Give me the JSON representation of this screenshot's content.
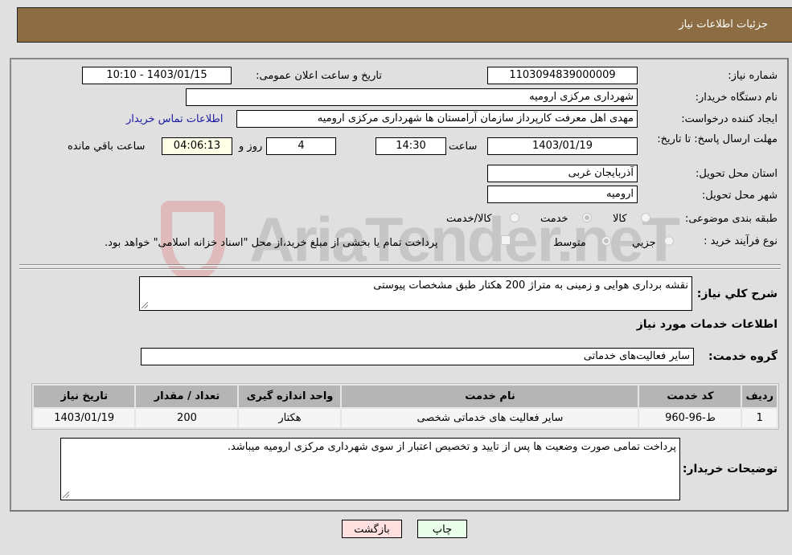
{
  "header": {
    "title": "جزئیات اطلاعات نیاز"
  },
  "form": {
    "need_number": {
      "label": "شماره نیاز:",
      "value": "1103094839000009"
    },
    "announce_datetime": {
      "label": "تاریخ و ساعت اعلان عمومی:",
      "value": "1403/01/15 - 10:10"
    },
    "buyer_org": {
      "label": "نام دستگاه خریدار:",
      "value": "شهرداری مرکزی ارومیه"
    },
    "creator": {
      "label": "ایجاد کننده درخواست:",
      "value": "مهدی اهل معرفت کارپرداز سازمان آرامستان ها شهرداری مرکزی ارومیه",
      "contact_link": "اطلاعات تماس خریدار"
    },
    "deadline": {
      "label": "مهلت ارسال پاسخ: تا تاریخ:",
      "date": "1403/01/19",
      "time_label": "ساعت",
      "time": "14:30",
      "days": "4",
      "days_label": "روز و",
      "remaining": "04:06:13",
      "remaining_label": "ساعت باقي مانده"
    },
    "province": {
      "label": "استان محل تحویل:",
      "value": "آذربایجان غربی"
    },
    "city": {
      "label": "شهر محل تحویل:",
      "value": "ارومیه"
    },
    "category": {
      "label": "طبقه بندی موضوعی:",
      "options": [
        {
          "label": "کالا",
          "checked": false
        },
        {
          "label": "خدمت",
          "checked": true
        },
        {
          "label": "کالا/خدمت",
          "checked": false
        }
      ]
    },
    "purchase_type": {
      "label": "نوع فرآیند خرید :",
      "options": [
        {
          "label": "جزيي",
          "checked": false
        },
        {
          "label": "متوسط",
          "checked": true
        }
      ],
      "treasury_note": "پرداخت تمام یا بخشی از مبلغ خرید،از محل \"اسناد خزانه اسلامی\" خواهد بود."
    },
    "description": {
      "label": "شرح کلي نیاز:",
      "value": "نقشه برداری هوایی و زمینی به متراژ 200 هکتار طبق مشخصات پیوستی"
    }
  },
  "services": {
    "section_title": "اطلاعات خدمات مورد نیاز",
    "group_label": "گروه خدمت:",
    "group_value": "سایر فعالیت‌های خدماتی",
    "table": {
      "headers": [
        "ردیف",
        "کد خدمت",
        "نام خدمت",
        "واحد اندازه گیری",
        "تعداد / مقدار",
        "تاریخ نیاز"
      ],
      "rows": [
        [
          "1",
          "ط-96-960",
          "سایر فعالیت های خدماتی شخصی",
          "هکتار",
          "200",
          "1403/01/19"
        ]
      ]
    }
  },
  "buyer_notes": {
    "label": "توضیحات خریدار:",
    "value": "پرداخت تمامی صورت وضعیت ها پس از تایید و تخصیص اعتبار از سوی شهرداری مرکزی ارومیه میباشد."
  },
  "buttons": {
    "print": "چاپ",
    "back": "بازگشت"
  },
  "watermark": {
    "text": "AriaTender.neT"
  },
  "colors": {
    "header_bg": "#8c6d43",
    "print_bg": "#eaffea",
    "back_bg": "#ffe0e0",
    "link": "#1a1aa6"
  }
}
